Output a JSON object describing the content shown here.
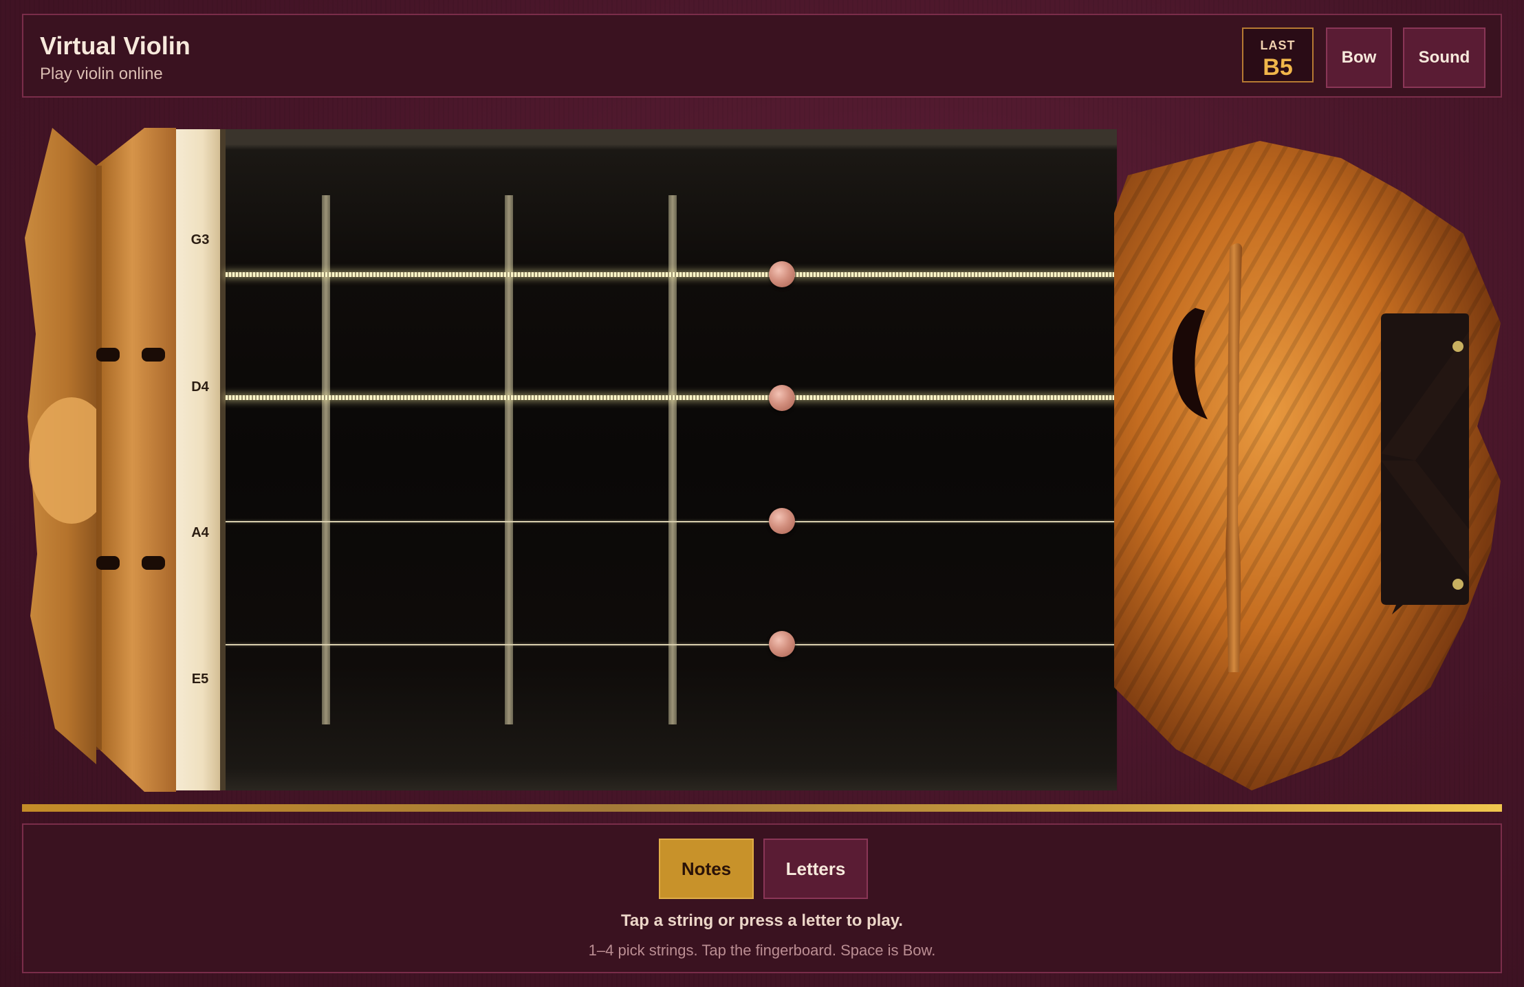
{
  "header": {
    "title": "Virtual Violin",
    "subtitle": "Play violin online",
    "last_label": "LAST",
    "last_note": "B5",
    "bow_label": "Bow",
    "sound_label": "Sound"
  },
  "strings": [
    {
      "label": "G3",
      "state": "active"
    },
    {
      "label": "D4",
      "state": "active"
    },
    {
      "label": "A4",
      "state": "idle"
    },
    {
      "label": "E5",
      "state": "idle"
    }
  ],
  "footer": {
    "modes": [
      "Notes",
      "Letters"
    ],
    "selected_mode": "Notes",
    "hint_primary": "Tap a string or press a letter to play.",
    "hint_secondary": "1–4 pick strings. Tap the fingerboard. Space is Bow."
  },
  "colors": {
    "background": "#461528",
    "panel": "#3a1220",
    "accent_gold": "#c8922a",
    "button": "#5a1c34",
    "string_glow": "#fff6c8",
    "finger_dot": "#d28f7e"
  }
}
